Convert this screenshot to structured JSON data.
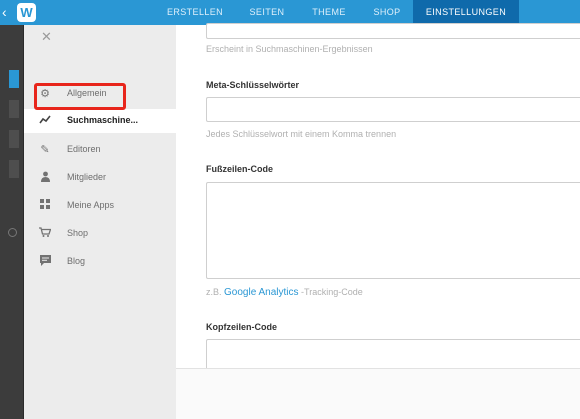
{
  "topbar": {
    "back_icon": "chevron-left-icon",
    "logo_letter": "W",
    "nav": [
      "ERSTELLEN",
      "SEITEN",
      "THEME",
      "SHOP",
      "EINSTELLUNGEN"
    ],
    "active_nav": "EINSTELLUNGEN"
  },
  "sidebar": {
    "close_icon": "close-icon",
    "items": [
      {
        "label": "Allgemein",
        "icon": "gear-icon"
      },
      {
        "label": "Suchmaschine...",
        "icon": "trending-icon"
      },
      {
        "label": "Editoren",
        "icon": "pencil-icon"
      },
      {
        "label": "Mitglieder",
        "icon": "person-icon"
      },
      {
        "label": "Meine Apps",
        "icon": "apps-grid-icon"
      },
      {
        "label": "Shop",
        "icon": "cart-icon"
      },
      {
        "label": "Blog",
        "icon": "chat-icon"
      }
    ],
    "selected": "Suchmaschine..."
  },
  "form": {
    "top_hint": "Erscheint in Suchmaschinen-Ergebnissen",
    "meta_label": "Meta-Schlüsselwörter",
    "meta_hint": "Jedes Schlüsselwort mit einem Komma trennen",
    "footer_code_label": "Fußzeilen-Code",
    "footer_hint_prefix": "z.B.",
    "footer_hint_link": "Google Analytics",
    "footer_hint_suffix": "-Tracking-Code",
    "header_code_label": "Kopfzeilen-Code"
  },
  "colors": {
    "accent": "#2a97d4",
    "active_tab": "#0f6aab",
    "highlight": "#e8251b"
  }
}
